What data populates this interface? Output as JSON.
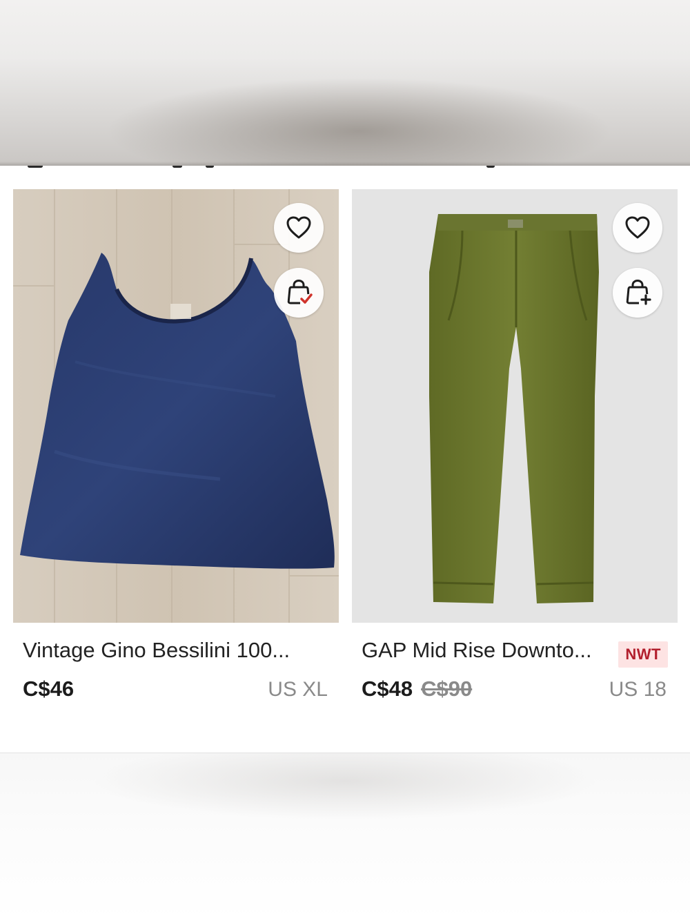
{
  "listings": [
    {
      "title": "Vintage Gino Bessilini 100...",
      "price": "C$46",
      "original_price": "",
      "size": "US XL",
      "badge": "",
      "liked": false,
      "in_bundle": true
    },
    {
      "title": "GAP Mid Rise Downto...",
      "price": "C$48",
      "original_price": "C$90",
      "size": "US 18",
      "badge": "NWT",
      "liked": false,
      "in_bundle": false
    }
  ],
  "icons": {
    "like": "heart-icon",
    "bundle_added": "bag-check-icon",
    "bundle_add": "bag-plus-icon"
  },
  "colors": {
    "check_accent": "#d0342c",
    "badge_bg": "#fde3e3",
    "badge_text": "#b21f2d"
  }
}
